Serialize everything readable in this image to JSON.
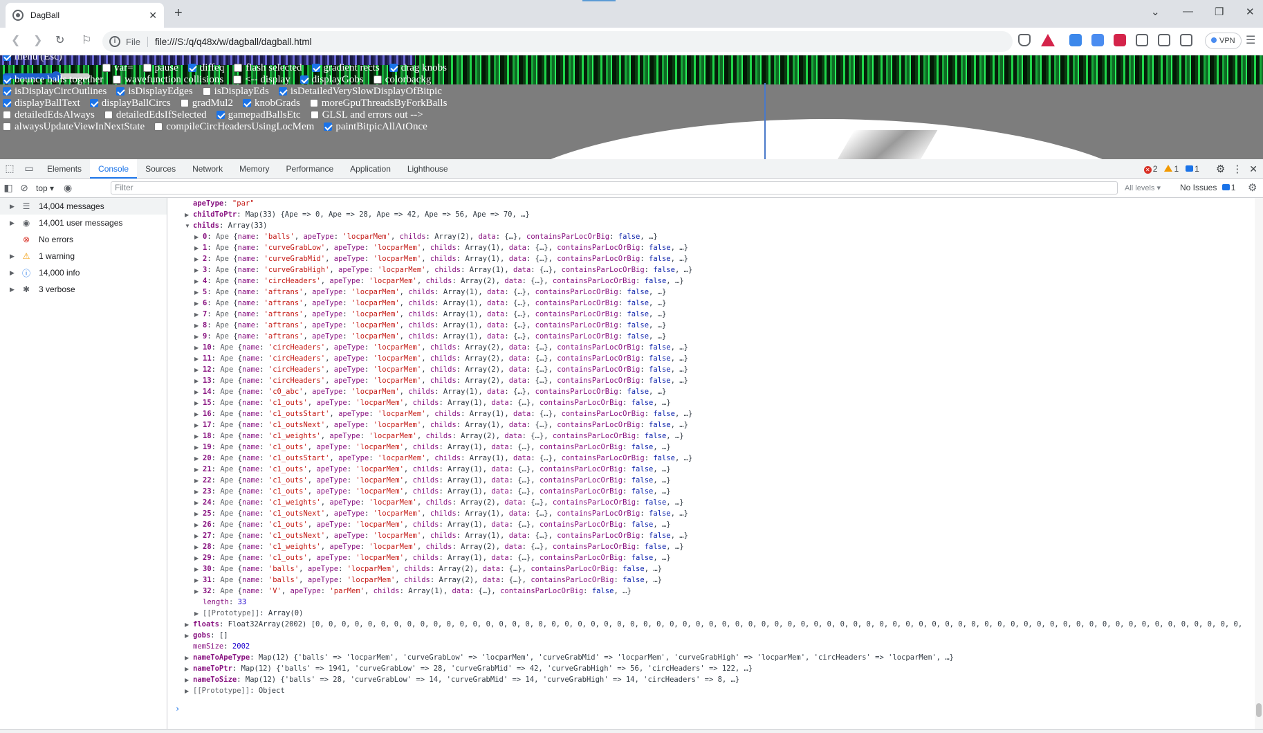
{
  "browser": {
    "tab_title": "DagBall",
    "new_tab": "+",
    "tab_close": "✕",
    "url_scheme": "File",
    "url": "file:///S:/q/q48x/w/dagball/dagball.html",
    "vpn_label": "VPN"
  },
  "page": {
    "options_rows": [
      [
        {
          "label": "menu (Esc)",
          "checked": true
        }
      ],
      [
        {
          "label": "var=",
          "checked": false
        },
        {
          "label": "pause",
          "checked": false
        },
        {
          "label": "diffeq",
          "checked": true
        },
        {
          "label": "flash selected",
          "checked": false
        },
        {
          "label": "gradient rects",
          "checked": true
        },
        {
          "label": "drag knobs",
          "checked": true
        }
      ],
      [
        {
          "label": "bounce balls together",
          "checked": true
        },
        {
          "label": "wavefunction collisions",
          "checked": false
        },
        {
          "label": "<-- display",
          "checked": false
        },
        {
          "label": "displayGobs",
          "checked": true
        },
        {
          "label": "colorbackg",
          "checked": false
        }
      ],
      [
        {
          "label": "isDisplayCircOutlines",
          "checked": true
        },
        {
          "label": "isDisplayEdges",
          "checked": true
        },
        {
          "label": "isDisplayEds",
          "checked": false
        },
        {
          "label": "isDetailedVerySlowDisplayOfBitpic",
          "checked": true
        }
      ],
      [
        {
          "label": "displayBallText",
          "checked": true
        },
        {
          "label": "displayBallCircs",
          "checked": true
        },
        {
          "label": "gradMul2",
          "checked": false
        },
        {
          "label": "knobGrads",
          "checked": true
        },
        {
          "label": "moreGpuThreadsByForkBalls",
          "checked": false
        }
      ],
      [
        {
          "label": "detailedEdsAlways",
          "checked": false
        },
        {
          "label": "detailedEdsIfSelected",
          "checked": false
        },
        {
          "label": "gamepadBallsEtc",
          "checked": true
        },
        {
          "label": "GLSL and errors out -->",
          "checked": false
        }
      ],
      [
        {
          "label": "alwaysUpdateViewInNextState",
          "checked": false
        },
        {
          "label": "compileCircHeadersUsingLocMem",
          "checked": false
        },
        {
          "label": "paintBitpicAllAtOnce",
          "checked": true
        }
      ]
    ]
  },
  "devtools": {
    "tabs": [
      "Elements",
      "Console",
      "Sources",
      "Network",
      "Memory",
      "Performance",
      "Application",
      "Lighthouse"
    ],
    "active_tab": "Console",
    "errors_count": "2",
    "warnings_count": "1",
    "info_count": "1",
    "context": "top",
    "filter_placeholder": "Filter",
    "levels": "All levels",
    "issues_label": "No Issues",
    "issues_count": "1",
    "sidebar": [
      {
        "label": "14,004 messages",
        "icon": "list-icon",
        "arrow": true
      },
      {
        "label": "14,001 user messages",
        "icon": "user-icon",
        "arrow": true
      },
      {
        "label": "No errors",
        "icon": "error-icon",
        "arrow": false
      },
      {
        "label": "1 warning",
        "icon": "warning-icon",
        "arrow": true
      },
      {
        "label": "14,000 info",
        "icon": "info-icon",
        "arrow": true
      },
      {
        "label": "3 verbose",
        "icon": "bug-icon",
        "arrow": true
      }
    ],
    "console_top": [
      {
        "indent": 1,
        "twisty": "",
        "key": "apeType",
        "sep": ": ",
        "val": "\"par\"",
        "vcls": "s"
      },
      {
        "indent": 1,
        "twisty": "▶",
        "key": "childToPtr",
        "sep": ": ",
        "val": "Map(33) {Ape => 0, Ape => 28, Ape => 42, Ape => 56, Ape => 70, …}",
        "vcls": "t"
      },
      {
        "indent": 1,
        "twisty": "▼",
        "key": "childs",
        "sep": ": ",
        "val": "Array(33)",
        "vcls": "t"
      }
    ],
    "childs": [
      {
        "i": "0",
        "name": "'balls'",
        "type": "'locparMem'",
        "childs": "Array(2)"
      },
      {
        "i": "1",
        "name": "'curveGrabLow'",
        "type": "'locparMem'",
        "childs": "Array(1)"
      },
      {
        "i": "2",
        "name": "'curveGrabMid'",
        "type": "'locparMem'",
        "childs": "Array(1)"
      },
      {
        "i": "3",
        "name": "'curveGrabHigh'",
        "type": "'locparMem'",
        "childs": "Array(1)"
      },
      {
        "i": "4",
        "name": "'circHeaders'",
        "type": "'locparMem'",
        "childs": "Array(2)"
      },
      {
        "i": "5",
        "name": "'aftrans'",
        "type": "'locparMem'",
        "childs": "Array(1)"
      },
      {
        "i": "6",
        "name": "'aftrans'",
        "type": "'locparMem'",
        "childs": "Array(1)"
      },
      {
        "i": "7",
        "name": "'aftrans'",
        "type": "'locparMem'",
        "childs": "Array(1)"
      },
      {
        "i": "8",
        "name": "'aftrans'",
        "type": "'locparMem'",
        "childs": "Array(1)"
      },
      {
        "i": "9",
        "name": "'aftrans'",
        "type": "'locparMem'",
        "childs": "Array(1)"
      },
      {
        "i": "10",
        "name": "'circHeaders'",
        "type": "'locparMem'",
        "childs": "Array(2)"
      },
      {
        "i": "11",
        "name": "'circHeaders'",
        "type": "'locparMem'",
        "childs": "Array(2)"
      },
      {
        "i": "12",
        "name": "'circHeaders'",
        "type": "'locparMem'",
        "childs": "Array(2)"
      },
      {
        "i": "13",
        "name": "'circHeaders'",
        "type": "'locparMem'",
        "childs": "Array(2)"
      },
      {
        "i": "14",
        "name": "'c0_abc'",
        "type": "'locparMem'",
        "childs": "Array(1)"
      },
      {
        "i": "15",
        "name": "'c1_outs'",
        "type": "'locparMem'",
        "childs": "Array(1)"
      },
      {
        "i": "16",
        "name": "'c1_outsStart'",
        "type": "'locparMem'",
        "childs": "Array(1)"
      },
      {
        "i": "17",
        "name": "'c1_outsNext'",
        "type": "'locparMem'",
        "childs": "Array(1)"
      },
      {
        "i": "18",
        "name": "'c1_weights'",
        "type": "'locparMem'",
        "childs": "Array(2)"
      },
      {
        "i": "19",
        "name": "'c1_outs'",
        "type": "'locparMem'",
        "childs": "Array(1)"
      },
      {
        "i": "20",
        "name": "'c1_outsStart'",
        "type": "'locparMem'",
        "childs": "Array(1)"
      },
      {
        "i": "21",
        "name": "'c1_outs'",
        "type": "'locparMem'",
        "childs": "Array(1)"
      },
      {
        "i": "22",
        "name": "'c1_outs'",
        "type": "'locparMem'",
        "childs": "Array(1)"
      },
      {
        "i": "23",
        "name": "'c1_outs'",
        "type": "'locparMem'",
        "childs": "Array(1)"
      },
      {
        "i": "24",
        "name": "'c1_weights'",
        "type": "'locparMem'",
        "childs": "Array(2)"
      },
      {
        "i": "25",
        "name": "'c1_outsNext'",
        "type": "'locparMem'",
        "childs": "Array(1)"
      },
      {
        "i": "26",
        "name": "'c1_outs'",
        "type": "'locparMem'",
        "childs": "Array(1)"
      },
      {
        "i": "27",
        "name": "'c1_outsNext'",
        "type": "'locparMem'",
        "childs": "Array(1)"
      },
      {
        "i": "28",
        "name": "'c1_weights'",
        "type": "'locparMem'",
        "childs": "Array(2)"
      },
      {
        "i": "29",
        "name": "'c1_outs'",
        "type": "'locparMem'",
        "childs": "Array(1)"
      },
      {
        "i": "30",
        "name": "'balls'",
        "type": "'locparMem'",
        "childs": "Array(2)"
      },
      {
        "i": "31",
        "name": "'balls'",
        "type": "'locparMem'",
        "childs": "Array(2)"
      },
      {
        "i": "32",
        "name": "'V'",
        "type": "'parMem'",
        "childs": "Array(1)"
      }
    ],
    "console_bottom": [
      {
        "indent": 2,
        "twisty": "",
        "key": "length",
        "sep": ": ",
        "val": "33",
        "vcls": "n",
        "kcls": "k"
      },
      {
        "indent": 2,
        "twisty": "▶",
        "key": "[[Prototype]]",
        "sep": ": ",
        "val": "Array(0)",
        "vcls": "t",
        "kcls": "g"
      },
      {
        "indent": 1,
        "twisty": "▶",
        "key": "floats",
        "sep": ": ",
        "val": "Float32Array(2002) [0, 0, 0, 0, 0, 0, 0, 0, 0, 0, 0, 0, 0, 0, 0, 0, 0, 0, 0, 0, 0, 0, 0, 0, 0, 0, 0, 0, 0, 0, 0, 0, 0, 0, 0, 0, 0, 0, 0, 0, 0, 0, 0, 0, 0, 0, 0, 0, 0, 0, 0, 0, 0, 0, 0, 0, 0, 0, 0, 0, 0, 0, 0, 0, 0, 0, 0, 0, 0, 0, 0,",
        "vcls": "t",
        "kcls": "kb"
      },
      {
        "indent": 1,
        "twisty": "▶",
        "key": "gobs",
        "sep": ": ",
        "val": "[]",
        "vcls": "t",
        "kcls": "kb"
      },
      {
        "indent": 1,
        "twisty": "",
        "key": "memSize",
        "sep": ": ",
        "val": "2002",
        "vcls": "n",
        "kcls": "k"
      },
      {
        "indent": 1,
        "twisty": "▶",
        "key": "nameToApeType",
        "sep": ": ",
        "val": "Map(12) {'balls' => 'locparMem', 'curveGrabLow' => 'locparMem', 'curveGrabMid' => 'locparMem', 'curveGrabHigh' => 'locparMem', 'circHeaders' => 'locparMem', …}",
        "vcls": "t",
        "kcls": "kb"
      },
      {
        "indent": 1,
        "twisty": "▶",
        "key": "nameToPtr",
        "sep": ": ",
        "val": "Map(12) {'balls' => 1941, 'curveGrabLow' => 28, 'curveGrabMid' => 42, 'curveGrabHigh' => 56, 'circHeaders' => 122, …}",
        "vcls": "t",
        "kcls": "kb"
      },
      {
        "indent": 1,
        "twisty": "▶",
        "key": "nameToSize",
        "sep": ": ",
        "val": "Map(12) {'balls' => 28, 'curveGrabLow' => 14, 'curveGrabMid' => 14, 'curveGrabHigh' => 14, 'circHeaders' => 8, …}",
        "vcls": "t",
        "kcls": "kb"
      },
      {
        "indent": 1,
        "twisty": "▶",
        "key": "[[Prototype]]",
        "sep": ": ",
        "val": "Object",
        "vcls": "t",
        "kcls": "g"
      }
    ],
    "ape_label": "Ape",
    "prompt": "›"
  }
}
